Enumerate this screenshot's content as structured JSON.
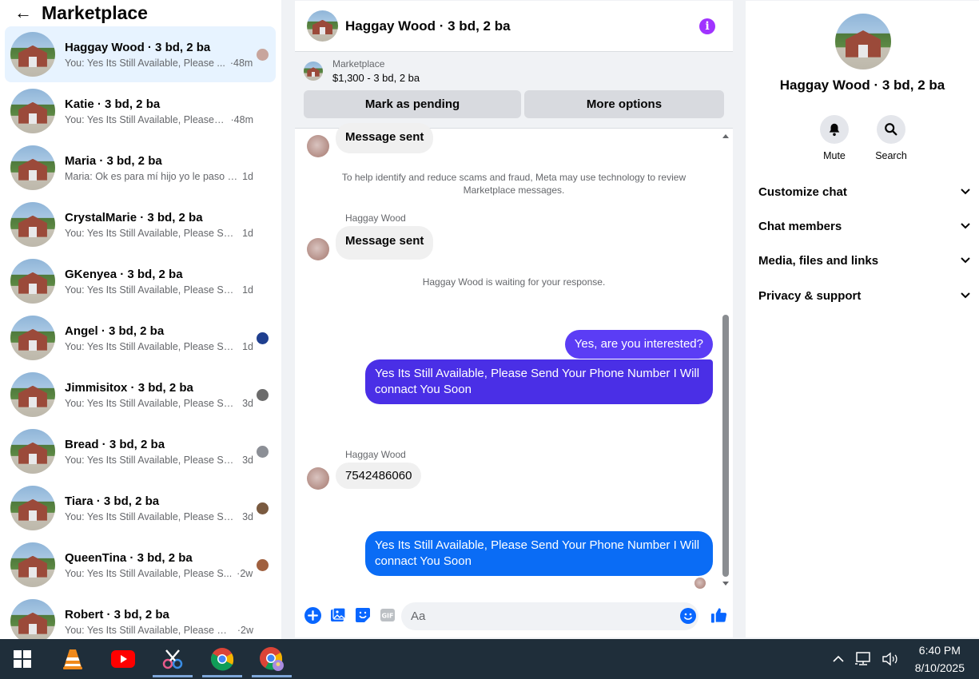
{
  "left": {
    "title": "Marketplace",
    "conversations": [
      {
        "name": "Haggay Wood · 3 bd, 2 ba",
        "preview": "You: Yes Its Still Available, Please ...",
        "time": "·48m",
        "mini_color": "#c8a59c"
      },
      {
        "name": "Katie · 3 bd, 2 ba",
        "preview": "You: Yes Its Still Available, Please Se...",
        "time": "·48m",
        "mini_color": ""
      },
      {
        "name": "Maria · 3 bd, 2 ba",
        "preview": "Maria: Ok es para mí hijo yo le paso la...",
        "time": "1d",
        "mini_color": ""
      },
      {
        "name": "CrystalMarie · 3 bd, 2 ba",
        "preview": "You: Yes Its Still Available, Please Send...",
        "time": "1d",
        "mini_color": ""
      },
      {
        "name": "GKenyea · 3 bd, 2 ba",
        "preview": "You: Yes Its Still Available, Please Send...",
        "time": "1d",
        "mini_color": ""
      },
      {
        "name": "Angel · 3 bd, 2 ba",
        "preview": "You: Yes Its Still Available, Please Se...",
        "time": "1d",
        "mini_color": "#1f3f8f"
      },
      {
        "name": "Jimmisitox · 3 bd, 2 ba",
        "preview": "You: Yes Its Still Available, Please Se...",
        "time": "3d",
        "mini_color": "#6b6b6b"
      },
      {
        "name": "Bread · 3 bd, 2 ba",
        "preview": "You: Yes Its Still Available, Please Se...",
        "time": "3d",
        "mini_color": "#8c8f96"
      },
      {
        "name": "Tiara · 3 bd, 2 ba",
        "preview": "You: Yes Its Still Available, Please Se...",
        "time": "3d",
        "mini_color": "#7a5a40"
      },
      {
        "name": "QueenTina · 3 bd, 2 ba",
        "preview": "You: Yes Its Still Available, Please S...",
        "time": "·2w",
        "mini_color": "#a0603f"
      },
      {
        "name": "Robert · 3 bd, 2 ba",
        "preview": "You: Yes Its Still Available, Please Send...",
        "time": "·2w",
        "mini_color": ""
      }
    ]
  },
  "chat": {
    "title": "Haggay Wood · 3 bd, 2 ba",
    "marketplace_label": "Marketplace",
    "listing": "$1,300 - 3 bd, 2 ba",
    "mark_pending": "Mark as pending",
    "more_options": "More options",
    "msg1": "Message sent",
    "scam_note": "To help identify and reduce scams and fraud, Meta may use technology to review Marketplace messages.",
    "sender": "Haggay Wood",
    "msg2": "Message sent",
    "waiting": "Haggay Wood is waiting for your response.",
    "out1": "Yes, are you interested?",
    "out2": "Yes Its Still Available, Please Send Your Phone Number I Will connact You Soon",
    "phone": "7542486060",
    "out3": "Yes Its Still Available, Please Send Your Phone Number I Will connact You Soon",
    "input_placeholder": "Aa",
    "colors": {
      "out_purple": "#5b3df5",
      "out_indigo": "#4a2fe6",
      "out_blue": "#0a6cf5",
      "accent": "#0866ff"
    }
  },
  "info": {
    "name": "Haggay Wood · 3 bd, 2 ba",
    "mute": "Mute",
    "search": "Search",
    "sections": [
      "Customize chat",
      "Chat members",
      "Media, files and links",
      "Privacy & support"
    ]
  },
  "taskbar": {
    "time": "6:40 PM",
    "date": "8/10/2025",
    "apps": [
      "windows-start",
      "vlc",
      "youtube",
      "snipping-tool",
      "chrome",
      "chrome-profile"
    ]
  }
}
